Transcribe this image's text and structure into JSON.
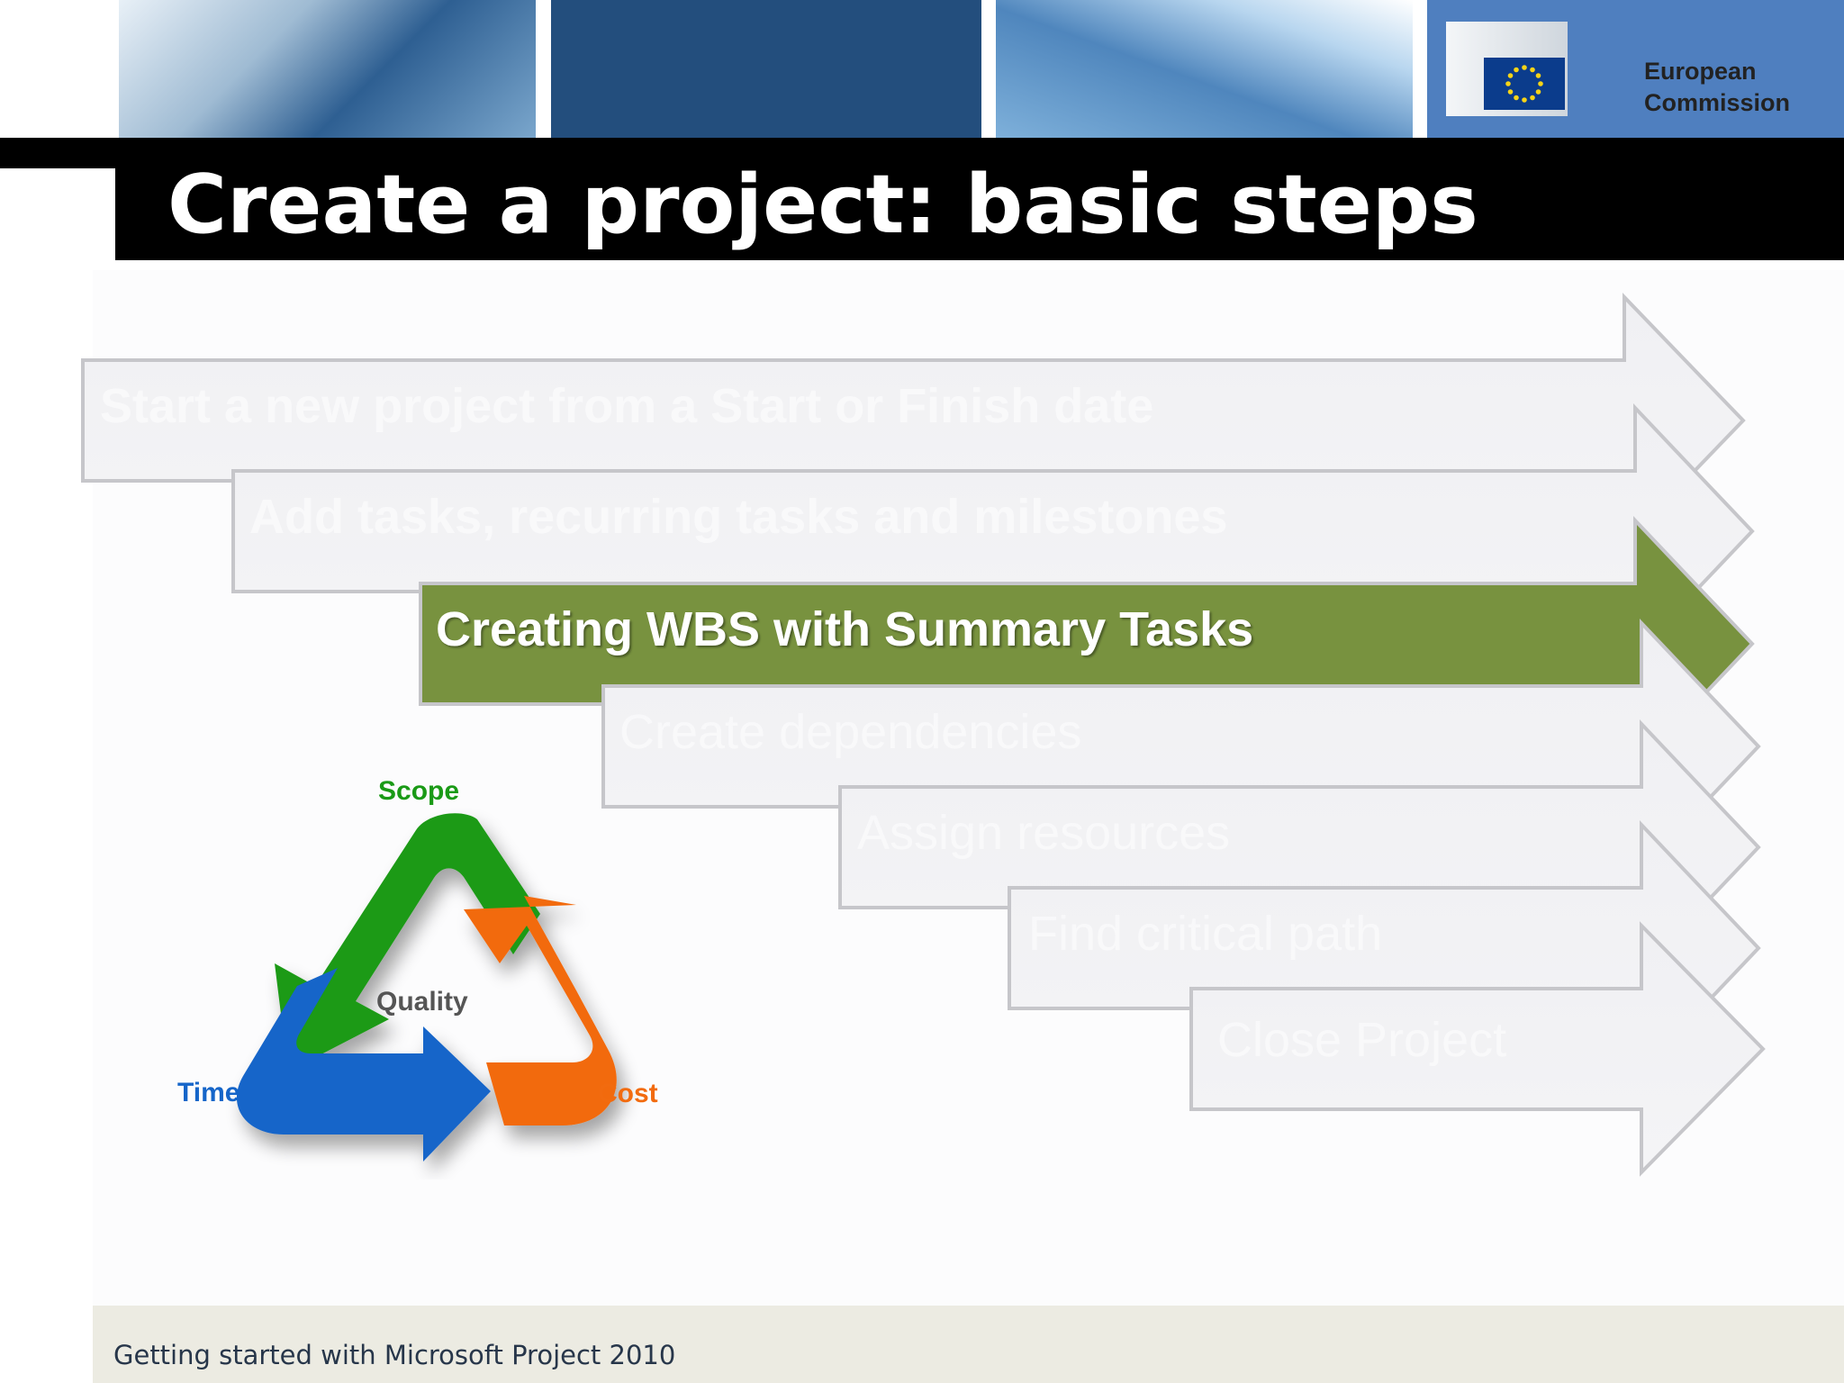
{
  "header": {
    "organization_line1": "European",
    "organization_line2": "Commission",
    "title": "Create a project: basic steps"
  },
  "steps": [
    {
      "label": "Start a new project from a Start or Finish date",
      "state": "dim"
    },
    {
      "label": "Add tasks, recurring tasks and milestones",
      "state": "dim"
    },
    {
      "label": "Creating WBS with Summary Tasks",
      "state": "active"
    },
    {
      "label": "Create dependencies",
      "state": "dim"
    },
    {
      "label": "Assign resources",
      "state": "dim"
    },
    {
      "label": "Find critical path",
      "state": "dim"
    },
    {
      "label": "Close Project",
      "state": "dim"
    }
  ],
  "cycle": {
    "scope": "Scope",
    "time": "Time",
    "cost": "Cost",
    "center": "Quality",
    "colors": {
      "scope": "#1a9a16",
      "time": "#1565c9",
      "cost": "#f26b0f",
      "center": "#555555"
    }
  },
  "colors": {
    "active_step": "#78923f",
    "dim_step": "#f2f2f4",
    "title_bar": "#000000",
    "footer_bg": "#ecebe2"
  },
  "footer": {
    "text": "Getting started with Microsoft Project 2010"
  }
}
